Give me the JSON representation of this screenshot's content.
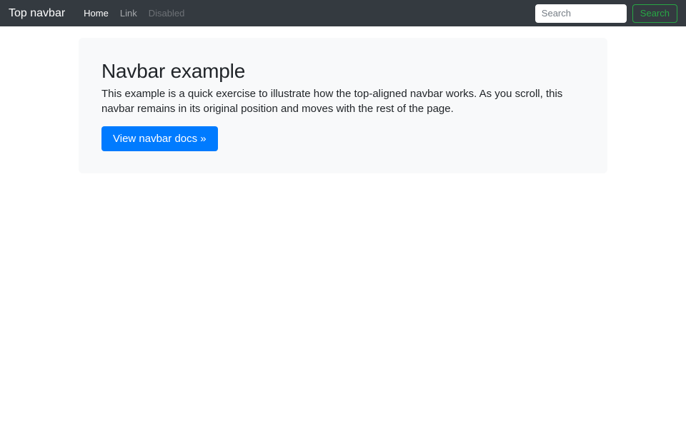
{
  "theme": {
    "navbar_bg": "#343a40",
    "primary": "#007bff",
    "success": "#28a745",
    "hero_bg": "#f8f9fa",
    "text": "#212529"
  },
  "navbar": {
    "brand": "Top navbar",
    "links": [
      {
        "label": "Home",
        "state": "active"
      },
      {
        "label": "Link",
        "state": "normal"
      },
      {
        "label": "Disabled",
        "state": "disabled"
      }
    ],
    "search": {
      "placeholder": "Search",
      "button_label": "Search"
    }
  },
  "hero": {
    "title": "Navbar example",
    "description": "This example is a quick exercise to illustrate how the top-aligned navbar works. As you scroll, this navbar remains in its original position and moves with the rest of the page.",
    "cta_label": "View navbar docs »"
  }
}
